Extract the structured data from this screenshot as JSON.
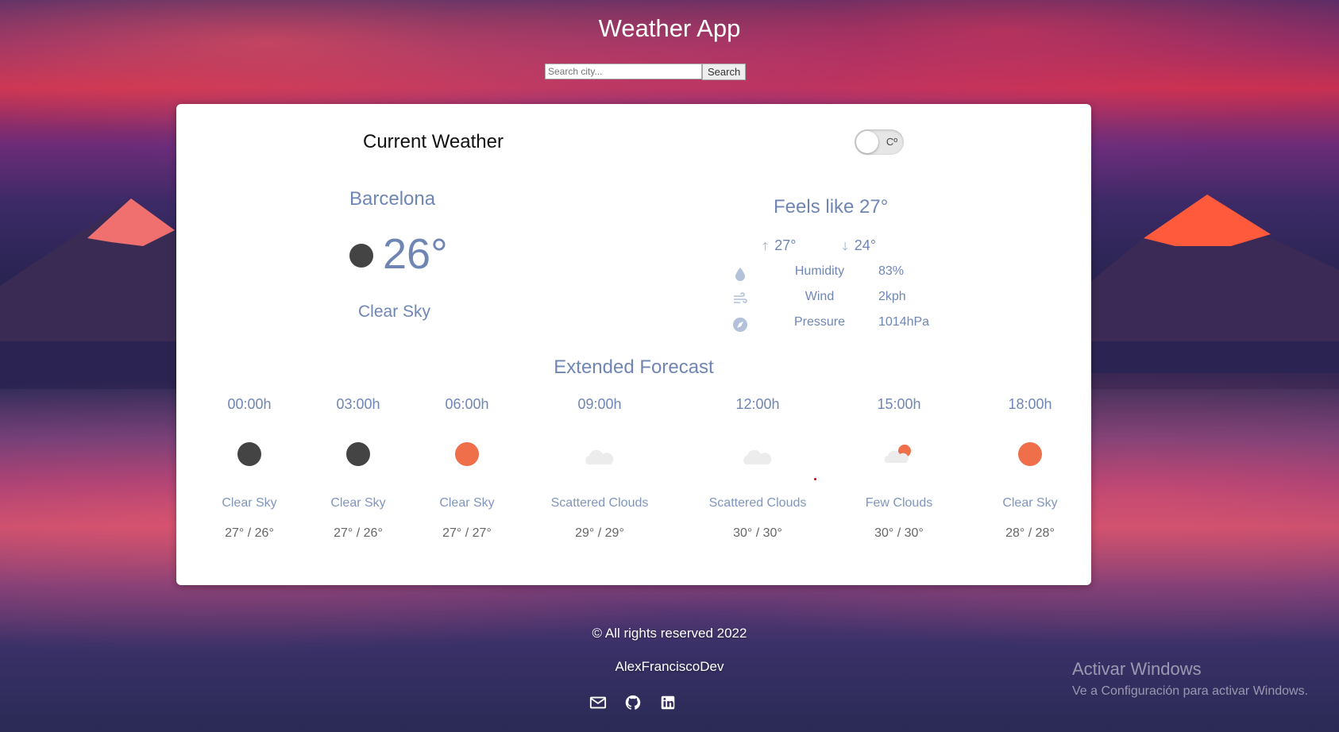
{
  "app": {
    "title": "Weather App"
  },
  "search": {
    "placeholder": "Search city...",
    "button_label": "Search"
  },
  "current": {
    "section_title": "Current Weather",
    "unit_toggle_label": "Cº",
    "city": "Barcelona",
    "temperature": "26°",
    "description": "Clear Sky",
    "icon": "moon-icon",
    "feels_like": "Feels like 27°",
    "max": "27°",
    "min": "24°",
    "details": [
      {
        "icon": "humidity-icon",
        "label": "Humidity",
        "value": "83%"
      },
      {
        "icon": "wind-icon",
        "label": "Wind",
        "value": "2kph"
      },
      {
        "icon": "pressure-icon",
        "label": "Pressure",
        "value": "1014hPa"
      }
    ]
  },
  "forecast": {
    "title": "Extended Forecast",
    "items": [
      {
        "time": "00:00h",
        "icon": "moon-icon",
        "description": "Clear Sky",
        "range": "27° / 26°"
      },
      {
        "time": "03:00h",
        "icon": "moon-icon",
        "description": "Clear Sky",
        "range": "27° / 26°"
      },
      {
        "time": "06:00h",
        "icon": "sun-icon",
        "description": "Clear Sky",
        "range": "27° / 27°"
      },
      {
        "time": "09:00h",
        "icon": "cloud-icon",
        "description": "Scattered Clouds",
        "range": "29° / 29°"
      },
      {
        "time": "12:00h",
        "icon": "cloud-icon",
        "description": "Scattered Clouds",
        "range": "30° / 30°"
      },
      {
        "time": "15:00h",
        "icon": "few-clouds-icon",
        "description": "Few Clouds",
        "range": "30° / 30°"
      },
      {
        "time": "18:00h",
        "icon": "sun-icon",
        "description": "Clear Sky",
        "range": "28° / 28°"
      }
    ]
  },
  "footer": {
    "copyright": "© All rights reserved 2022",
    "author": "AlexFranciscoDev",
    "links": [
      "mail-icon",
      "github-icon",
      "linkedin-icon"
    ]
  },
  "os_watermark": {
    "title": "Activar Windows",
    "subtitle": "Ve a Configuración para activar Windows."
  },
  "colors": {
    "accent_blue": "#6f86b5",
    "sun": "#ee6f4a",
    "moon": "#444444",
    "cloud": "#eeeeee"
  }
}
